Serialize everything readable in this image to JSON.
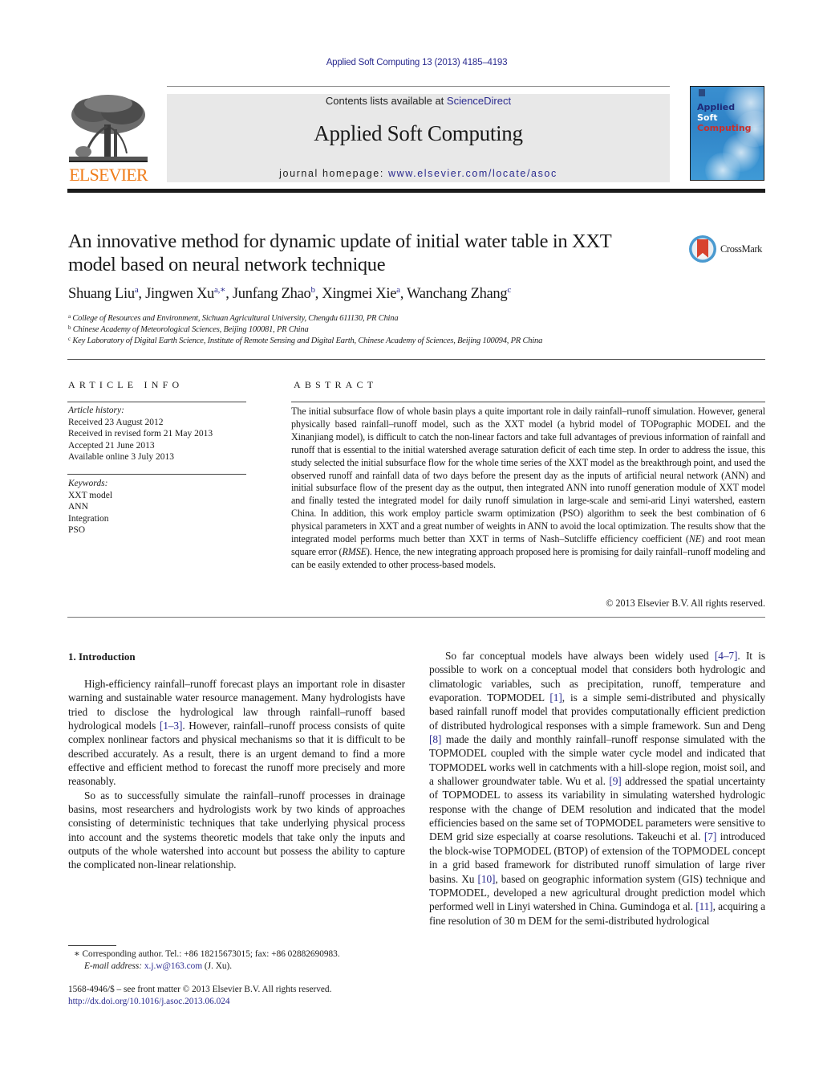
{
  "journal_citation": "Applied Soft Computing 13 (2013) 4185–4193",
  "header": {
    "publisher_logo_text": "ELSEVIER",
    "contents_prefix": "Contents lists available at ",
    "contents_link": "ScienceDirect",
    "journal_name": "Applied Soft Computing",
    "homepage_prefix": "journal homepage: ",
    "homepage_link": "www.elsevier.com/locate/asoc",
    "cover": {
      "line1": "Applied",
      "line2": "Soft",
      "line3": "Computing"
    },
    "colors": {
      "publisher_orange": "#f07d1a",
      "link_blue": "#2b2b8f",
      "cover_blue": "#3a8fd0",
      "cover_red": "#c8302c"
    }
  },
  "article": {
    "title": "An innovative method for dynamic update of initial water table in XXT model based on neural network technique",
    "crossmark_label": "CrossMark",
    "authors": [
      {
        "name": "Shuang Liu",
        "sup": "a",
        "sep": ", "
      },
      {
        "name": "Jingwen Xu",
        "sup": "a,∗",
        "sep": ", "
      },
      {
        "name": "Junfang Zhao",
        "sup": "b",
        "sep": ", "
      },
      {
        "name": "Xingmei Xie",
        "sup": "a",
        "sep": ", "
      },
      {
        "name": "Wanchang Zhang",
        "sup": "c",
        "sep": ""
      }
    ],
    "affiliations": [
      {
        "key": "a",
        "text": "College of Resources and Environment, Sichuan Agricultural University, Chengdu 611130, PR China"
      },
      {
        "key": "b",
        "text": "Chinese Academy of Meteorological Sciences, Beijing 100081, PR China"
      },
      {
        "key": "c",
        "text": "Key Laboratory of Digital Earth Science, Institute of Remote Sensing and Digital Earth, Chinese Academy of Sciences, Beijing 100094, PR China"
      }
    ]
  },
  "article_info": {
    "heading": "ARTICLE INFO",
    "history_label": "Article history:",
    "history": [
      "Received 23 August 2012",
      "Received in revised form 21 May 2013",
      "Accepted 21 June 2013",
      "Available online 3 July 2013"
    ],
    "keywords_label": "Keywords:",
    "keywords": [
      "XXT model",
      "ANN",
      "Integration",
      "PSO"
    ]
  },
  "abstract": {
    "heading": "ABSTRACT",
    "text_part1": "The initial subsurface flow of whole basin plays a quite important role in daily rainfall–runoff simulation. However, general physically based rainfall–runoff model, such as the XXT model (a hybrid model of TOPographic MODEL and the Xinanjiang model), is difficult to catch the non-linear factors and take full advantages of previous information of rainfall and runoff that is essential to the initial watershed average saturation deficit of each time step. In order to address the issue, this study selected the initial subsurface flow for the whole time series of the XXT model as the breakthrough point, and used the observed runoff and rainfall data of two days before the present day as the inputs of artificial neural network (ANN) and initial subsurface flow of the present day as the output, then integrated ANN into runoff generation module of XXT model and finally tested the integrated model for daily runoff simulation in large-scale and semi-arid Linyi watershed, eastern China. In addition, this work employ particle swarm optimization (PSO) algorithm to seek the best combination of 6 physical parameters in XXT and a great number of weights in ANN to avoid the local optimization. The results show that the integrated model performs much better than XXT in terms of Nash–Sutcliffe efficiency coefficient (",
    "ne": "NE",
    "text_part2": ") and root mean square error (",
    "rmse": "RMSE",
    "text_part3": "). Hence, the new integrating approach proposed here is promising for daily rainfall–runoff modeling and can be easily extended to other process-based models.",
    "copyright": "© 2013 Elsevier B.V. All rights reserved."
  },
  "introduction": {
    "heading": "1.  Introduction",
    "p1": [
      "High-efficiency rainfall–runoff forecast plays an important role in disaster warning and sustainable water resource management. Many hydrologists have tried to disclose the hydrological law through rainfall–runoff based hydrological models ",
      "[1–3]",
      ". However, rainfall–runoff process consists of quite complex nonlinear factors and physical mechanisms so that it is difficult to be described accurately. As a result, there is an urgent demand to find a more effective and efficient method to forecast the runoff more precisely and more reasonably."
    ],
    "p2": "So as to successfully simulate the rainfall–runoff processes in drainage basins, most researchers and hydrologists work by two kinds of approaches consisting of deterministic techniques that take underlying physical process into account and the systems theoretic models that take only the inputs and outputs of the whole watershed into account but possess the ability to capture the complicated non-linear relationship.",
    "p3": [
      "So far conceptual models have always been widely used ",
      "[4–7]",
      ". It is possible to work on a conceptual model that considers both hydrologic and climatologic variables, such as precipitation, runoff, temperature and evaporation. TOPMODEL ",
      "[1]",
      ", is a simple semi-distributed and physically based rainfall runoff model that provides computationally efficient prediction of distributed hydrological responses with a simple framework. Sun and Deng ",
      "[8]",
      " made the daily and monthly rainfall–runoff response simulated with the TOPMODEL coupled with the simple water cycle model and indicated that TOPMODEL works well in catchments with a hill-slope region, moist soil, and a shallower groundwater table. Wu et al. ",
      "[9]",
      " addressed the spatial uncertainty of TOPMODEL to assess its variability in simulating watershed hydrologic response with the change of DEM resolution and indicated that the model efficiencies based on the same set of TOPMODEL parameters were sensitive to DEM grid size especially at coarse resolutions. Takeuchi et al. ",
      "[7]",
      " introduced the block-wise TOPMODEL (BTOP) of extension of the TOPMODEL concept in a grid based framework for distributed runoff simulation of large river basins. Xu ",
      "[10]",
      ", based on geographic information system (GIS) technique and TOPMODEL, developed a new agricultural drought prediction model which performed well in Linyi watershed in China. Gumindoga et al. ",
      "[11]",
      ", acquiring a fine resolution of 30 m DEM for the semi-distributed hydrological"
    ]
  },
  "footnotes": {
    "corresponding_marker": "∗",
    "corresponding": "Corresponding author. Tel.: +86 18215673015; fax: +86 02882690983.",
    "email_label": "E-mail address: ",
    "email": "x.j.w@163.com",
    "email_suffix": " (J. Xu).",
    "issn_line": "1568-4946/$ – see front matter © 2013 Elsevier B.V. All rights reserved.",
    "doi": "http://dx.doi.org/10.1016/j.asoc.2013.06.024"
  }
}
